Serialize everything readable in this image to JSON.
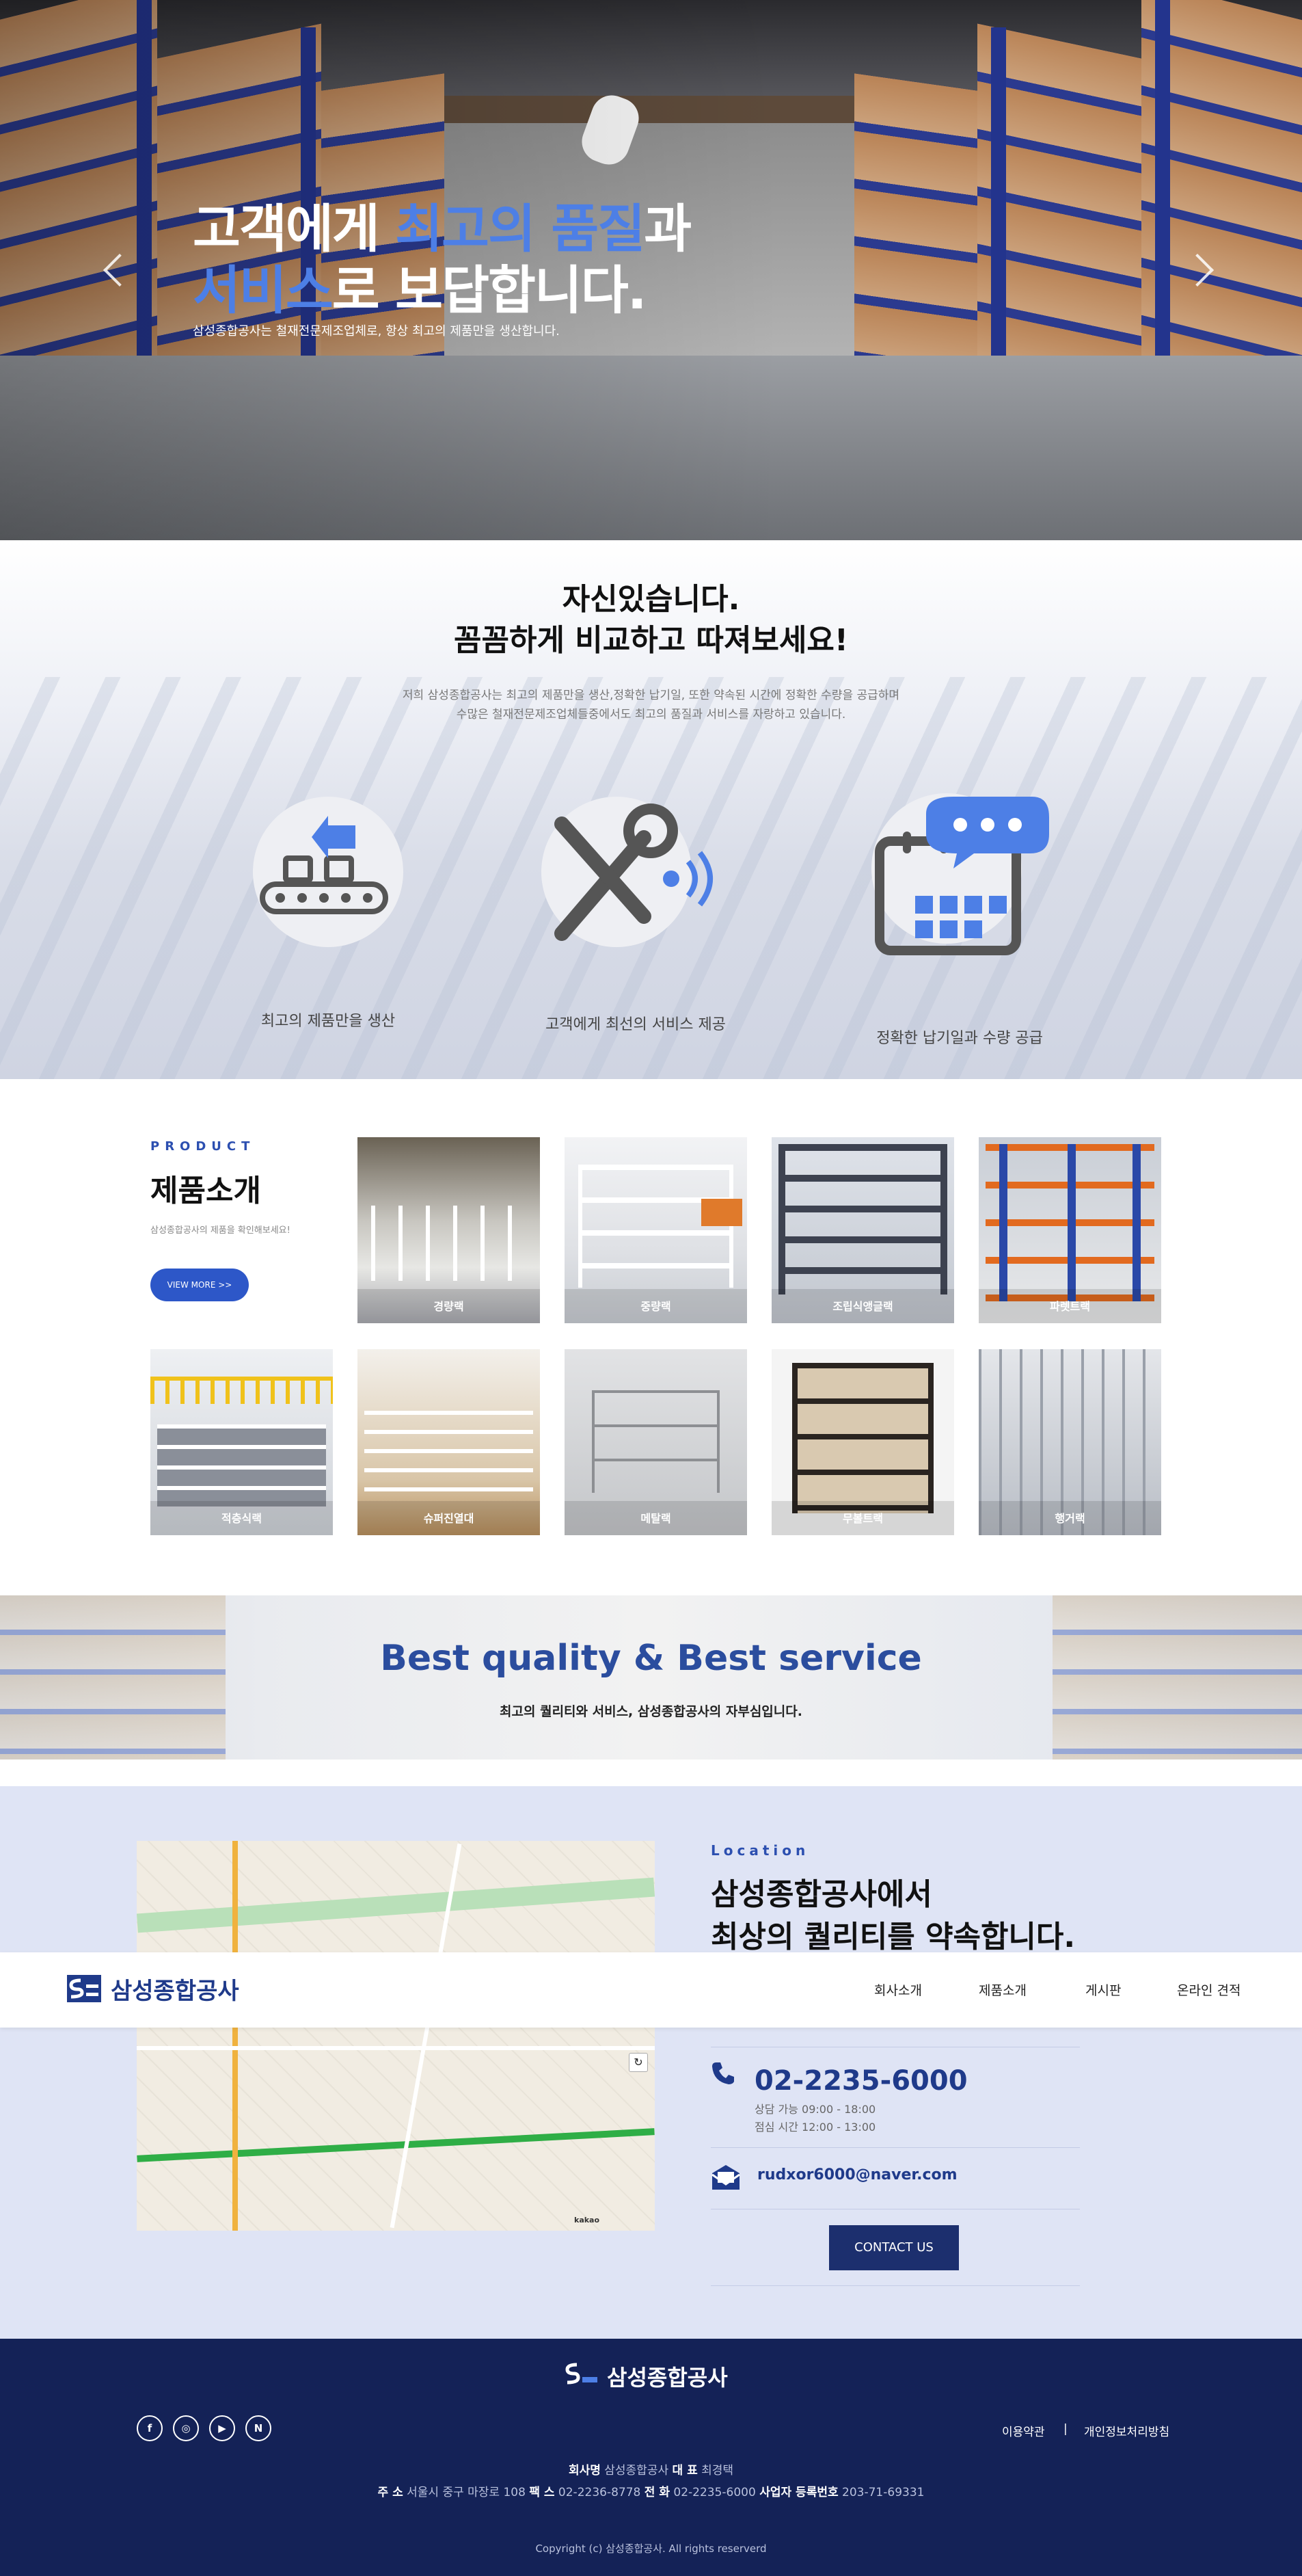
{
  "hero": {
    "title_line1_pre": "고객에게 ",
    "title_line1_hl": "최고의 품질",
    "title_line1_post": "과",
    "title_line2_hl": "서비스",
    "title_line2_post": "로 보답합니다.",
    "subtitle": "삼성종합공사는 철재전문제조업체로, 항상 최고의 제품만을 생산합니다."
  },
  "confident": {
    "title_line1": "자신있습니다.",
    "title_line2": "꼼꼼하게 비교하고 따져보세요!",
    "desc_line1": "저희 삼성종합공사는 최고의 제품만을 생산,정확한 납기일, 또한 약속된 시간에 정확한 수량을 공급하며",
    "desc_line2": "수많은 철재전문제조업체들중에서도 최고의 품질과 서비스를 자랑하고 있습니다.",
    "features": [
      {
        "label": "최고의 제품만을 생산",
        "icon": "conveyor-icon"
      },
      {
        "label": "고객에게 최선의 서비스 제공",
        "icon": "tools-icon"
      },
      {
        "label": "정확한 납기일과 수량 공급",
        "icon": "calendar-chat-icon"
      }
    ],
    "accent": "#4d7fe6"
  },
  "product": {
    "eyebrow": "PRODUCT",
    "title": "제품소개",
    "desc": "삼성종합공사의 제품을 확인해보세요!",
    "more": "VIEW MORE >>",
    "items": [
      {
        "label": "경량랙"
      },
      {
        "label": "중량랙"
      },
      {
        "label": "조립식앵글랙"
      },
      {
        "label": "파렛트랙"
      },
      {
        "label": "적층식랙"
      },
      {
        "label": "슈퍼진열대"
      },
      {
        "label": "메탈랙"
      },
      {
        "label": "무볼트랙"
      },
      {
        "label": "행거랙"
      }
    ]
  },
  "banner": {
    "title": "Best quality & Best service",
    "subtitle": "최고의 퀄리티와 서비스, 삼성종합공사의 자부심입니다."
  },
  "location": {
    "eyebrow": "Location",
    "title_line1": "삼성종합공사에서",
    "title_line2": "최상의 퀄리티를 약속합니다.",
    "phone": "02-2235-6000",
    "hours_line1": "상담 가능 09:00 - 18:00",
    "hours_line2": "점심 시간 12:00 - 13:00",
    "email": "rudxor6000@naver.com",
    "contact_btn": "CONTACT US",
    "map_brand": "kakao"
  },
  "nav": {
    "logo_text": "삼성종합공사",
    "items": [
      "회사소개",
      "제품소개",
      "게시판",
      "온라인 견적"
    ]
  },
  "footer": {
    "logo_text": "삼성종합공사",
    "links": [
      "이용약관",
      "개인정보처리방침"
    ],
    "divider": "|",
    "social": [
      "facebook-icon",
      "instagram-icon",
      "youtube-icon",
      "naver-icon"
    ],
    "social_glyphs": [
      "f",
      "◎",
      "▶",
      "N"
    ],
    "company_label": "회사명",
    "company": "삼성종합공사",
    "ceo_label": "대 표",
    "ceo": "최경택",
    "addr_label": "주 소",
    "addr": "서울시 중구 마장로 108",
    "fax_label": "팩 스",
    "fax": "02-2236-8778",
    "tel_label": "전 화",
    "tel": "02-2235-6000",
    "biz_label": "사업자 등록번호",
    "biz": "203-71-69331",
    "copyright": "Copyright (c) 삼성종합공사. All rights reserverd"
  },
  "colors": {
    "brand": "#2d57c8",
    "navy": "#142257",
    "highlight": "#4d7fe6"
  }
}
